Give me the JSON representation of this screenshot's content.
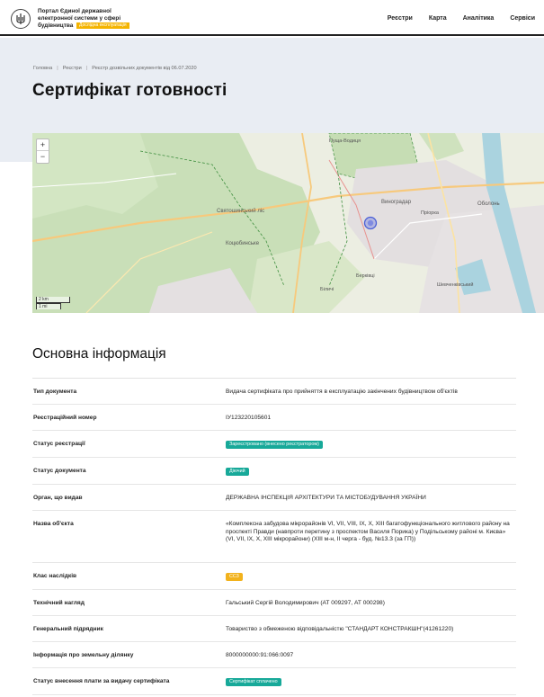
{
  "header": {
    "portal_name": "Портал Єдиної державної електронної системи у сфері будівництва",
    "beta_label": "Дослідна експлуатація",
    "nav": [
      "Реєстри",
      "Карта",
      "Аналітика",
      "Сервіси"
    ]
  },
  "breadcrumb": [
    "Головна",
    "Реєстри",
    "Реєстр дозвільних документів від 06.07.2020"
  ],
  "page_title": "Сертифікат готовності",
  "map": {
    "zoom_in": "+",
    "zoom_out": "−",
    "scale_km": "2 km",
    "scale_mi": "1 mi",
    "labels": [
      "Святошинський ліс",
      "Коцюбинське",
      "Виноградар",
      "Пуща-Водиця",
      "Оболонь",
      "Пріорка",
      "Біличі",
      "Берківці",
      "Шевченківський"
    ],
    "marker_color": "#5b6ee1"
  },
  "section_title": "Основна інформація",
  "info": [
    {
      "label": "Тип документа",
      "value": "Видача сертифіката про прийняття в експлуатацію закінчених будівництвом об'єктів"
    },
    {
      "label": "Реєстраційний номер",
      "value": "ІУ123220105601"
    },
    {
      "label": "Статус реєстрації",
      "badge": "Зареєстровано (внесено реєстратором)",
      "badge_color": "#17a999"
    },
    {
      "label": "Статус документа",
      "badge": "Діючий",
      "badge_color": "#17a999"
    },
    {
      "label": "Орган, що видав",
      "value": "ДЕРЖАВНА ІНСПЕКЦІЯ АРХІТЕКТУРИ ТА МІСТОБУДУВАННЯ УКРАЇНИ"
    },
    {
      "label": "Назва об'єкта",
      "value": "«Комплексна забудова мікрорайонів VI, VII, VIII, IX, X, XIII багатофункціонального житлового району на проспекті Правди (навпроти перетину з проспектом Василя Порика) у Подільському районі м. Києва» (VI, VII, IX, X, XIII мікрорайони) (XIII м-н, ІІ черга - буд. №13.3 (за ГП))"
    },
    {
      "label": "Клас наслідків",
      "badge": "СС3",
      "badge_color": "#f2b21c"
    },
    {
      "label": "Технічний нагляд",
      "value": "Гальський Сергій Володимирович (АТ 009297, АТ 000298)"
    },
    {
      "label": "Генеральний підрядник",
      "value": "Товариство з обмеженою відповідальністю \"СТАНДАРТ КОНСТРАКШН\"(41261220)"
    },
    {
      "label": "Інформація про земельну ділянку",
      "value": "8000000000:91:066:0097"
    },
    {
      "label": "Статус внесення плати за видачу сертифіката",
      "badge": "Сертифікат сплачено",
      "badge_color": "#17a999"
    }
  ]
}
